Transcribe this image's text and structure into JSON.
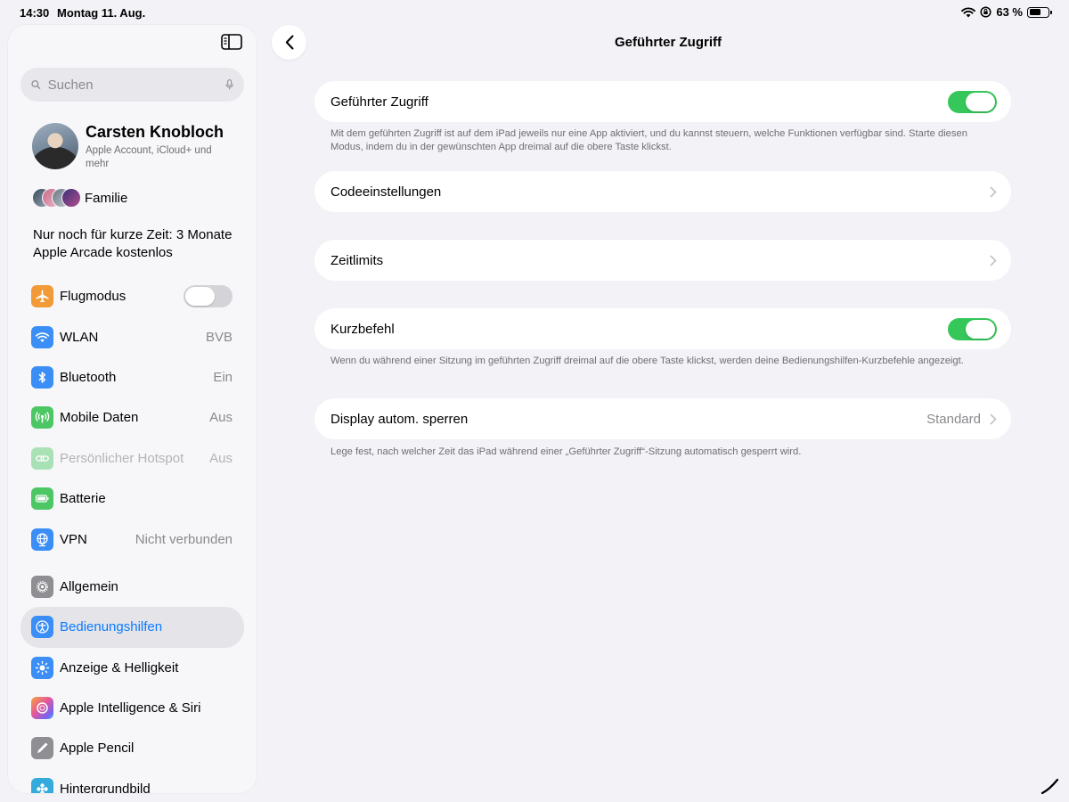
{
  "status_bar": {
    "time": "14:30",
    "date": "Montag 11. Aug.",
    "battery_text": "63 %",
    "battery_level": 0.63
  },
  "sidebar": {
    "search": {
      "placeholder": "Suchen",
      "value": ""
    },
    "profile": {
      "name": "Carsten Knobloch",
      "subtitle": "Apple Account, iCloud+ und mehr"
    },
    "family_label": "Familie",
    "promo": "Nur noch für kurze Zeit: 3 Monate Apple Arcade kostenlos",
    "group1": [
      {
        "label": "Flugmodus",
        "icon": "airplane-icon",
        "color": "#f19a37",
        "toggle": false
      },
      {
        "label": "WLAN",
        "icon": "wifi-icon",
        "color": "#3a8ef6",
        "value": "BVB"
      },
      {
        "label": "Bluetooth",
        "icon": "bluetooth-icon",
        "color": "#3a8ef6",
        "value": "Ein"
      },
      {
        "label": "Mobile Daten",
        "icon": "antenna-icon",
        "color": "#4cc764",
        "value": "Aus"
      },
      {
        "label": "Persönlicher Hotspot",
        "icon": "hotspot-icon",
        "color": "#4cc764",
        "value": "Aus",
        "disabled": true
      },
      {
        "label": "Batterie",
        "icon": "battery-icon",
        "color": "#4cc764"
      },
      {
        "label": "VPN",
        "icon": "vpn-globe-icon",
        "color": "#3a8ef6",
        "value": "Nicht verbunden"
      }
    ],
    "group2": [
      {
        "label": "Allgemein",
        "icon": "gear-icon",
        "color": "#8e8e93"
      },
      {
        "label": "Bedienungshilfen",
        "icon": "accessibility-icon",
        "color": "#3a8ef6",
        "selected": true
      },
      {
        "label": "Anzeige & Helligkeit",
        "icon": "sun-icon",
        "color": "#3a8ef6"
      },
      {
        "label": "Apple Intelligence & Siri",
        "icon": "siri-icon",
        "color": "#d66bd8"
      },
      {
        "label": "Apple Pencil",
        "icon": "pencil-icon",
        "color": "#8e8e93"
      },
      {
        "label": "Hintergrundbild",
        "icon": "wallpaper-icon",
        "color": "#35aadc"
      }
    ]
  },
  "main": {
    "title": "Geführter Zugriff",
    "guided_access": {
      "label": "Geführter Zugriff",
      "on": true,
      "footnote": "Mit dem geführten Zugriff ist auf dem iPad jeweils nur eine App aktiviert, und du kannst steuern, welche Funktionen verfügbar sind. Starte diesen Modus, indem du in der gewünschten App dreimal auf die obere Taste klickst."
    },
    "passcode": {
      "label": "Codeeinstellungen"
    },
    "time_limits": {
      "label": "Zeitlimits"
    },
    "shortcut": {
      "label": "Kurzbefehl",
      "on": true,
      "footnote": "Wenn du während einer Sitzung im geführten Zugriff dreimal auf die obere Taste klickst, werden deine Bedienungshilfen-Kurzbefehle angezeigt."
    },
    "auto_lock": {
      "label": "Display autom. sperren",
      "value": "Standard",
      "footnote": "Lege fest, nach welcher Zeit das iPad während einer „Geführter Zugriff“-Sitzung automatisch gesperrt wird."
    }
  },
  "colors": {
    "accent": "#0a7aff",
    "switch_on": "#35c759",
    "background": "#f2f2f7"
  }
}
